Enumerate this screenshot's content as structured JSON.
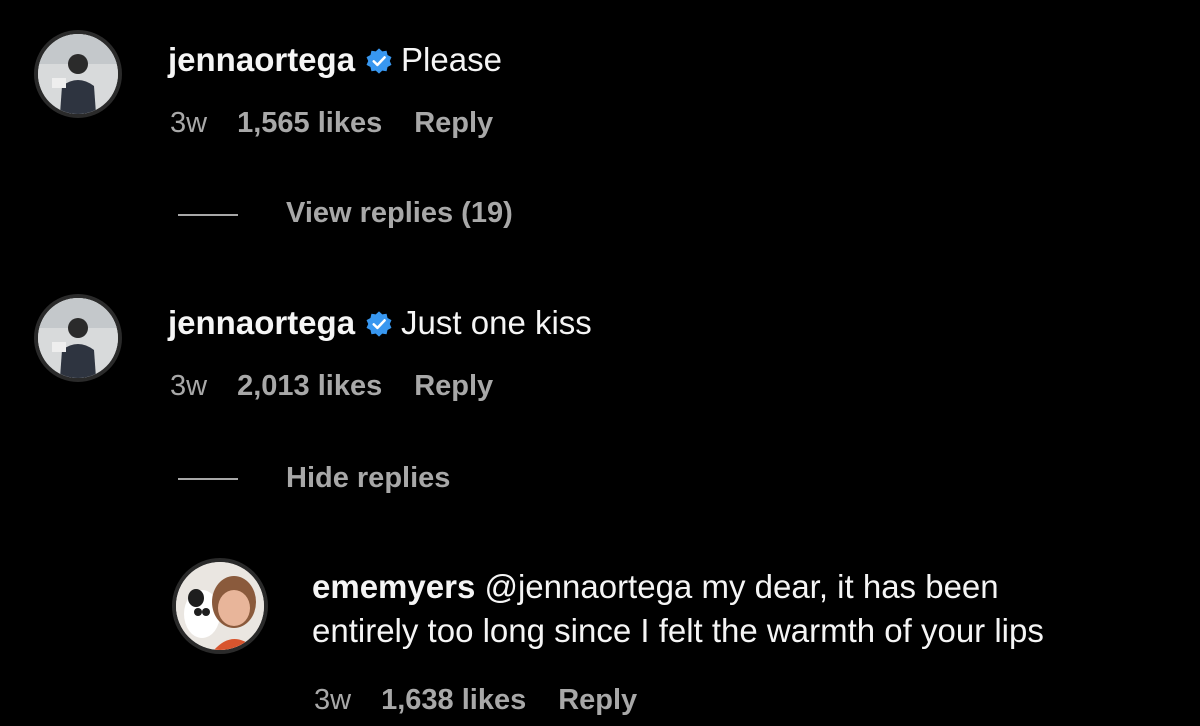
{
  "comments": [
    {
      "username": "jennaortega",
      "text": "Please",
      "time": "3w",
      "likes": "1,565 likes",
      "reply": "Reply",
      "replies_toggle": "View replies (19)"
    },
    {
      "username": "jennaortega",
      "text": "Just one kiss",
      "time": "3w",
      "likes": "2,013 likes",
      "reply": "Reply",
      "replies_toggle": "Hide replies"
    }
  ],
  "reply_comment": {
    "username": "ememyers",
    "text_line1": "@jennaortega my dear, it has been",
    "text_line2": "entirely too long since I felt the warmth of your lips",
    "time": "3w",
    "likes": "1,638 likes",
    "reply": "Reply"
  },
  "icons": {
    "verified": "verified-badge-icon"
  },
  "colors": {
    "background": "#000000",
    "primary_text": "#f5f5f5",
    "secondary_text": "#a8a8a8",
    "verified_blue": "#3897f0"
  }
}
